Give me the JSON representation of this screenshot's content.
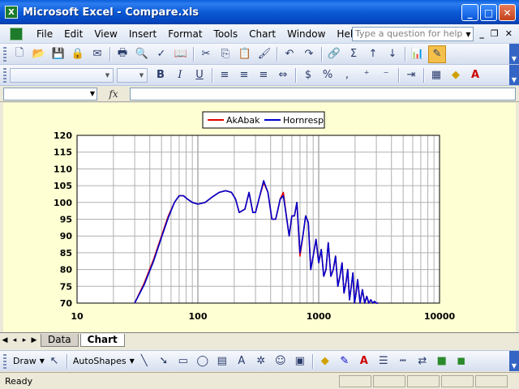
{
  "window": {
    "app_icon_glyph": "X",
    "title": "Microsoft Excel - Compare.xls",
    "min_glyph": "_",
    "max_glyph": "□",
    "close_glyph": "✕"
  },
  "menu": {
    "items": [
      "File",
      "Edit",
      "View",
      "Insert",
      "Format",
      "Tools",
      "Chart",
      "Window",
      "Help"
    ],
    "help_placeholder": "Type a question for help",
    "doc_min": "_",
    "doc_restore": "❐",
    "doc_close": "✕"
  },
  "formula_bar": {
    "name_box": "",
    "fx_label": "fx",
    "formula": ""
  },
  "chart_data": {
    "type": "line",
    "title": "",
    "xlabel": "",
    "ylabel": "",
    "x_scale": "log",
    "xlim": [
      10,
      10000
    ],
    "ylim": [
      70,
      120
    ],
    "x_ticks": [
      "10",
      "100",
      "1000",
      "10000"
    ],
    "y_ticks": [
      "70",
      "75",
      "80",
      "85",
      "90",
      "95",
      "100",
      "105",
      "110",
      "115",
      "120"
    ],
    "grid": true,
    "legend_position": "top-center",
    "series": [
      {
        "name": "AkAbak",
        "color": "#e00000",
        "x": [
          30,
          36,
          43,
          50,
          57,
          64,
          70,
          76,
          82,
          90,
          100,
          115,
          130,
          150,
          170,
          190,
          205,
          220,
          245,
          265,
          285,
          300,
          320,
          350,
          380,
          410,
          440,
          460,
          480,
          510,
          540,
          570,
          600,
          630,
          660,
          700,
          740,
          780,
          820,
          860,
          900,
          950,
          1000,
          1050,
          1100,
          1150,
          1200,
          1260,
          1320,
          1380,
          1440,
          1500,
          1560,
          1620,
          1680,
          1740,
          1800,
          1860,
          1920,
          1980,
          2040,
          2100,
          2200,
          2300,
          2400,
          2500,
          2600,
          2700,
          2800,
          2900,
          3000,
          3100
        ],
        "y": [
          70,
          76,
          83,
          90,
          96,
          100,
          102,
          102,
          101,
          100,
          99.5,
          100,
          101.5,
          103,
          103.5,
          103,
          101,
          97,
          98,
          103,
          97,
          97,
          101,
          106,
          103,
          95,
          95,
          98,
          101,
          103,
          96,
          90,
          96,
          96,
          100,
          84,
          90,
          96,
          94,
          80,
          84,
          89,
          82,
          86,
          78,
          80,
          88,
          78,
          80,
          84,
          75,
          78,
          82,
          73,
          76,
          80,
          71,
          75,
          79,
          70,
          73,
          77,
          70,
          74,
          70,
          72,
          70,
          71,
          70,
          70.5,
          70,
          70
        ]
      },
      {
        "name": "Hornresp",
        "color": "#0000cc",
        "x": [
          30,
          36,
          43,
          50,
          57,
          64,
          70,
          76,
          82,
          90,
          100,
          115,
          130,
          150,
          170,
          190,
          205,
          220,
          245,
          265,
          285,
          300,
          320,
          350,
          380,
          410,
          440,
          460,
          480,
          510,
          540,
          570,
          600,
          630,
          660,
          700,
          740,
          780,
          820,
          860,
          900,
          950,
          1000,
          1050,
          1100,
          1150,
          1200,
          1260,
          1320,
          1380,
          1440,
          1500,
          1560,
          1620,
          1680,
          1740,
          1800,
          1860,
          1920,
          1980,
          2040,
          2100,
          2200,
          2300,
          2400,
          2500,
          2600,
          2700,
          2800,
          2900,
          3000,
          3100
        ],
        "y": [
          70,
          75.5,
          82.5,
          89.5,
          95.5,
          100,
          102,
          102,
          101,
          100,
          99.5,
          100,
          101.5,
          103,
          103.5,
          103,
          101,
          97,
          98,
          103,
          97,
          97,
          101,
          106.5,
          103,
          95,
          95,
          98,
          101,
          102,
          96,
          90,
          96,
          96,
          100,
          85,
          90,
          96,
          94,
          80,
          84,
          89,
          82,
          86,
          78,
          80,
          88,
          78,
          80,
          84,
          75,
          78,
          82,
          73,
          76,
          80,
          71,
          75,
          79,
          70,
          73,
          77,
          70,
          74,
          70,
          72,
          70,
          71,
          70,
          70.5,
          70,
          70
        ]
      }
    ]
  },
  "tabs": {
    "items": [
      "Data",
      "Chart"
    ],
    "active": "Chart"
  },
  "draw_toolbar": {
    "draw_label": "Draw",
    "autoshapes_label": "AutoShapes"
  },
  "status": {
    "text": "Ready"
  }
}
